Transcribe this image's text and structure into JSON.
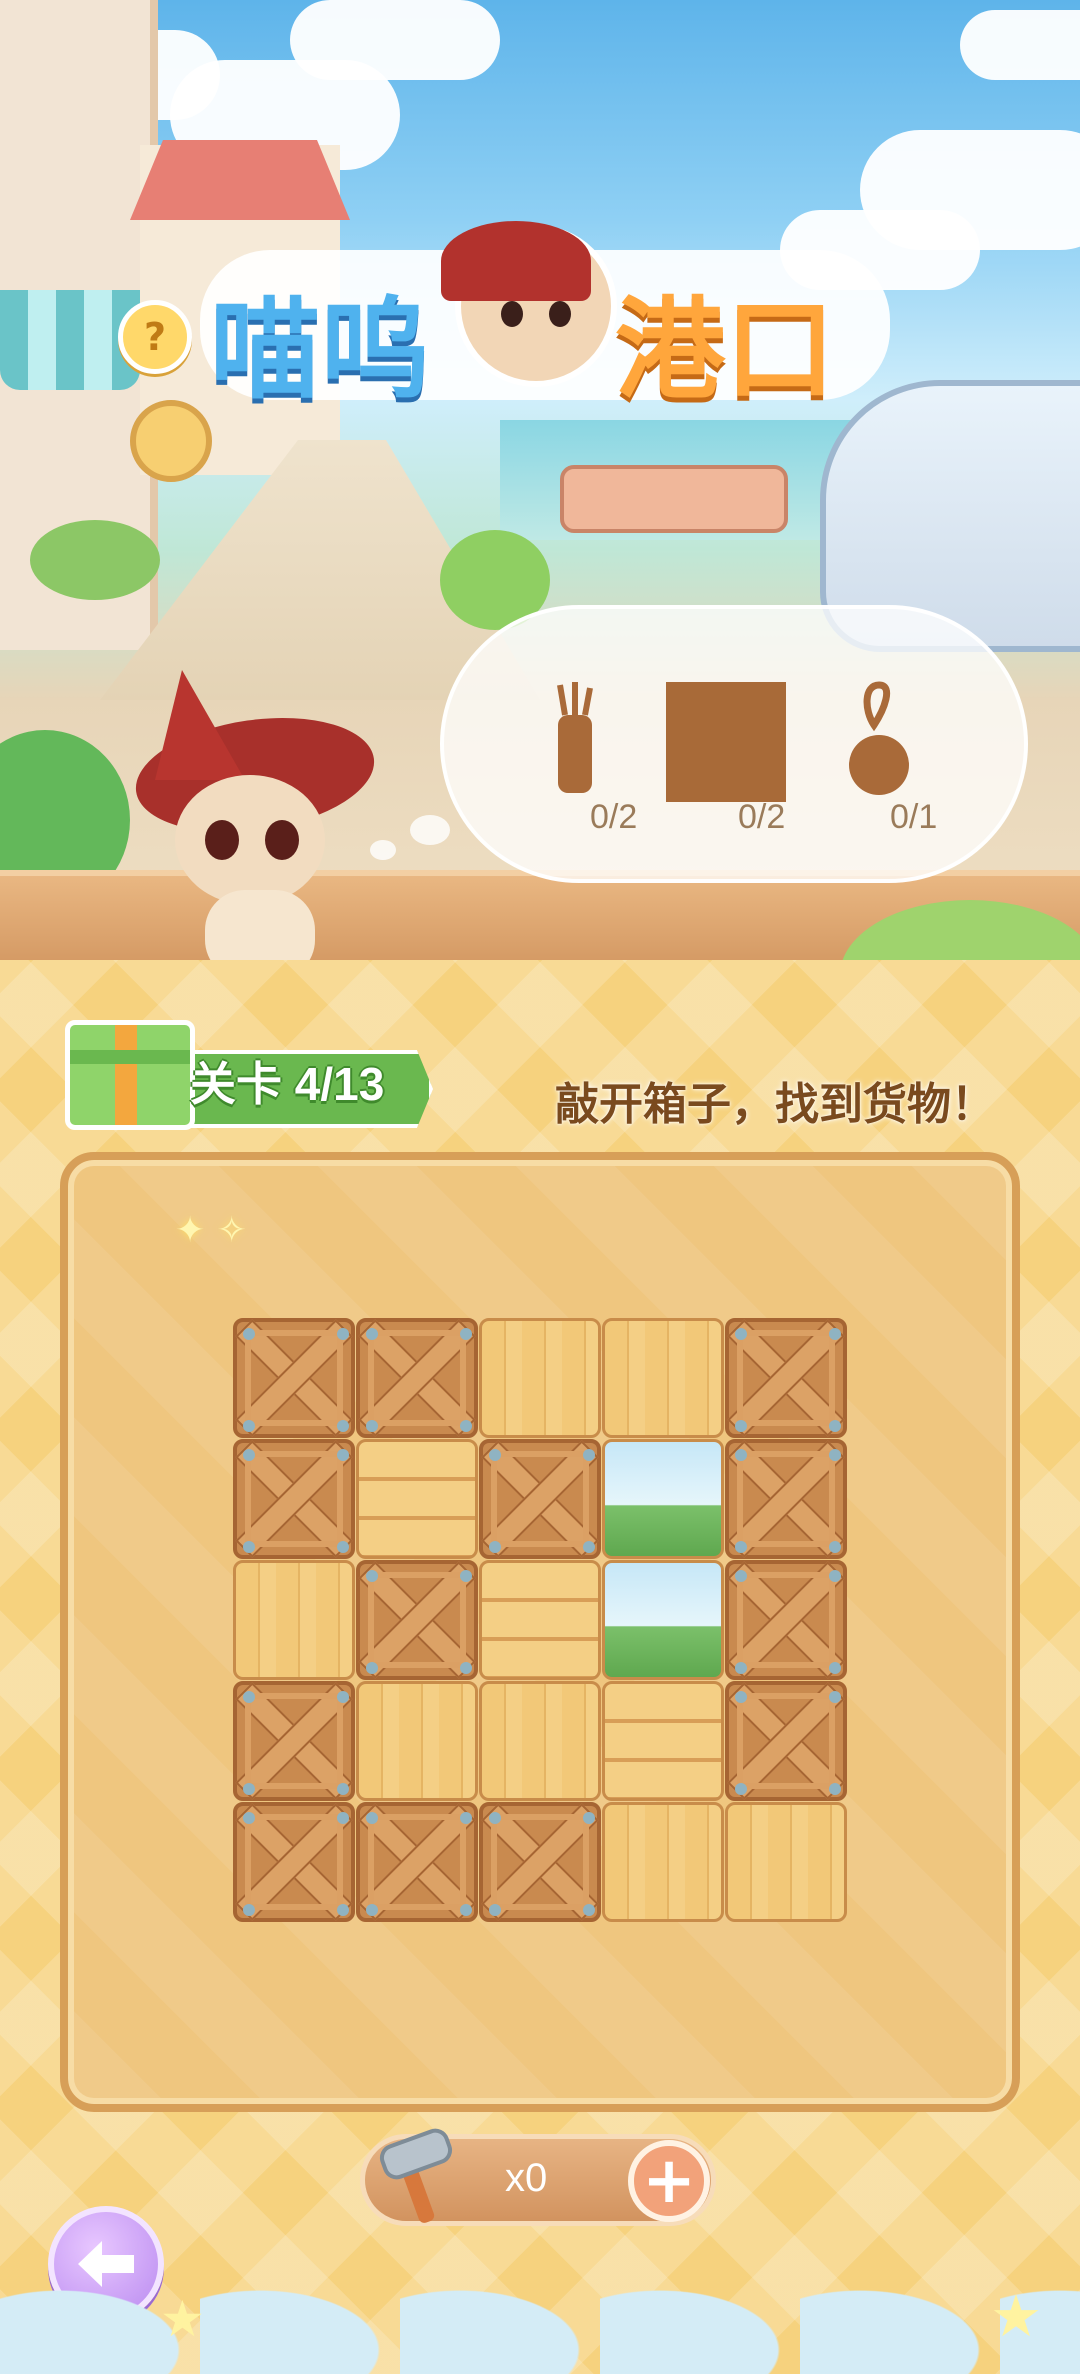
{
  "game": {
    "title_left": "喵呜",
    "title_right": "港口",
    "help_label": "?"
  },
  "goals": {
    "items": [
      {
        "icon": "golf-bag-icon",
        "count": "0/2"
      },
      {
        "icon": "photo-frame-icon",
        "count": "0/2"
      },
      {
        "icon": "bell-icon",
        "count": "0/1"
      }
    ]
  },
  "level": {
    "label": "关卡 4/13",
    "instruction": "敲开箱子，找到货物！"
  },
  "board": {
    "rows": [
      [
        "closed",
        "closed",
        "open-v",
        "open-v",
        "closed"
      ],
      [
        "closed",
        "open-h",
        "closed",
        "revealed",
        "closed"
      ],
      [
        "open-v",
        "closed",
        "open-h",
        "revealed",
        "closed"
      ],
      [
        "closed",
        "open-v",
        "open-v",
        "open-h",
        "closed"
      ],
      [
        "closed",
        "closed",
        "closed",
        "open-v",
        "open-v"
      ]
    ]
  },
  "tools": {
    "hammer_count": "x0",
    "add_label": "+"
  },
  "colors": {
    "accent": "#f6d27e",
    "board": "#efc67f",
    "crate": "#c98a4f",
    "level_badge": "#6ab84f"
  }
}
